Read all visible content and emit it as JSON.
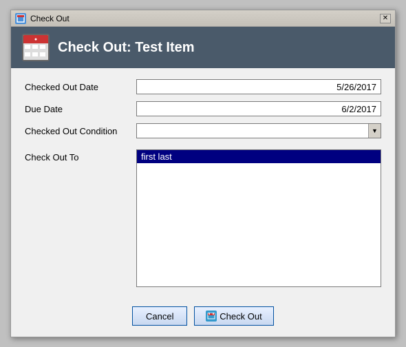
{
  "window": {
    "title": "Check Out",
    "close_label": "✕"
  },
  "header": {
    "title": "Check Out: Test Item",
    "icon_alt": "calendar-icon"
  },
  "form": {
    "checked_out_date_label": "Checked Out Date",
    "checked_out_date_value": "5/26/2017",
    "due_date_label": "Due Date",
    "due_date_value": "6/2/2017",
    "checked_out_condition_label": "Checked Out Condition",
    "checked_out_condition_value": "",
    "check_out_to_label": "Check Out To",
    "check_out_to_selected": "first last"
  },
  "buttons": {
    "cancel_label": "Cancel",
    "checkout_label": "Check Out"
  }
}
